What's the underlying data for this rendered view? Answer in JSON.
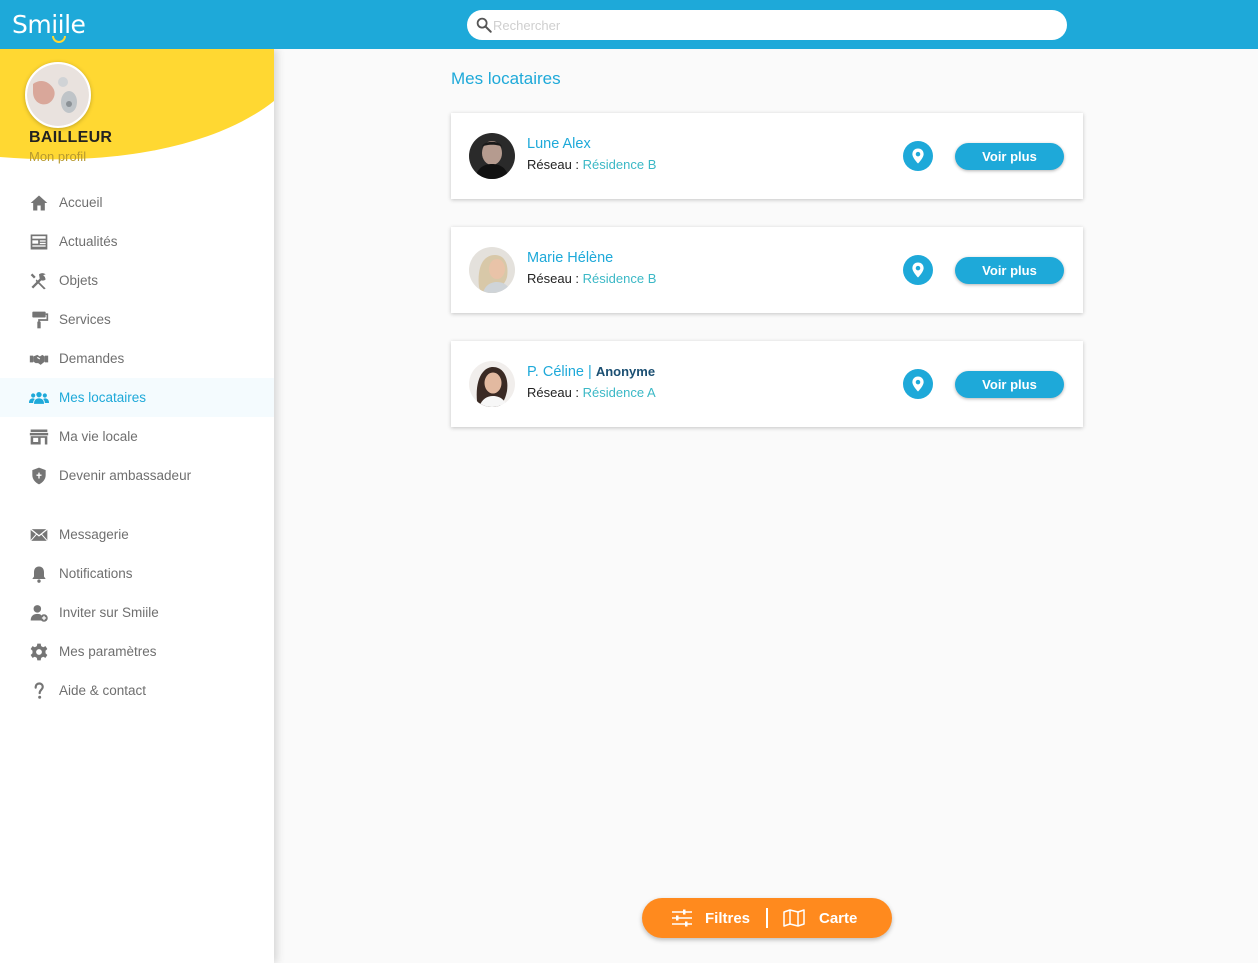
{
  "app": {
    "logo_text": "Smiile"
  },
  "search": {
    "placeholder": "Rechercher"
  },
  "profile": {
    "role": "BAILLEUR",
    "link": "Mon profil"
  },
  "nav": {
    "main": [
      {
        "label": "Accueil",
        "icon": "home-icon"
      },
      {
        "label": "Actualités",
        "icon": "news-icon"
      },
      {
        "label": "Objets",
        "icon": "tools-icon"
      },
      {
        "label": "Services",
        "icon": "paint-roller-icon"
      },
      {
        "label": "Demandes",
        "icon": "handshake-icon"
      },
      {
        "label": "Mes locataires",
        "icon": "group-icon",
        "active": true
      },
      {
        "label": "Ma vie locale",
        "icon": "store-icon"
      },
      {
        "label": "Devenir ambassadeur",
        "icon": "shield-icon"
      }
    ],
    "secondary": [
      {
        "label": "Messagerie",
        "icon": "mail-icon"
      },
      {
        "label": "Notifications",
        "icon": "bell-icon"
      },
      {
        "label": "Inviter sur Smiile",
        "icon": "add-user-icon"
      },
      {
        "label": "Mes paramètres",
        "icon": "gear-icon"
      },
      {
        "label": "Aide & contact",
        "icon": "help-icon"
      }
    ]
  },
  "main": {
    "title": "Mes locataires",
    "reseau_label": "Réseau : ",
    "button_label": "Voir plus",
    "tenants": [
      {
        "name": "Lune Alex",
        "tag": "",
        "reseau": "Résidence B"
      },
      {
        "name": "Marie Hélène",
        "tag": "",
        "reseau": "Résidence B"
      },
      {
        "name": "P. Céline",
        "tag": "Anonyme",
        "reseau": "Résidence A"
      }
    ]
  },
  "bottom_bar": {
    "filters_label": "Filtres",
    "map_label": "Carte"
  },
  "colors": {
    "primary": "#1ea9d9",
    "accent_yellow": "#ffd832",
    "accent_orange": "#ff8a1e",
    "reseau": "#3bb8c6"
  }
}
